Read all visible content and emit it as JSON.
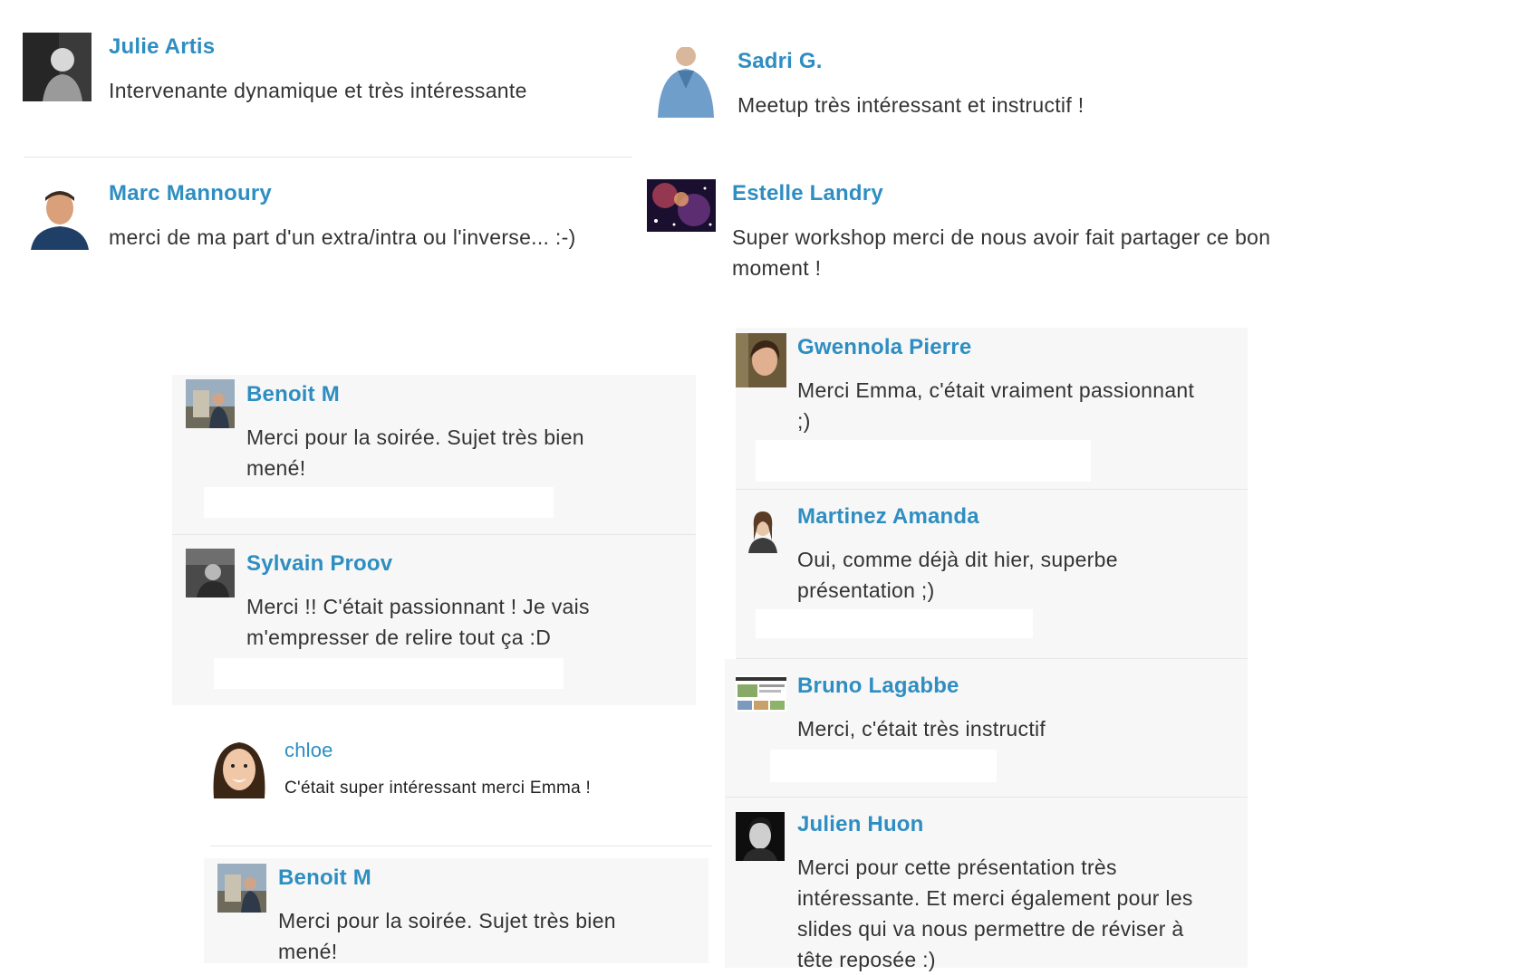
{
  "comments": [
    {
      "name": "Julie Artis",
      "message": "Intervenante dynamique et très intéressante",
      "avatar_icon": "avatar-julie-artis-icon"
    },
    {
      "name": "Sadri G.",
      "message": "Meetup très intéressant et instructif !",
      "avatar_icon": "avatar-sadri-g-icon"
    },
    {
      "name": "Marc Mannoury",
      "message": "merci de ma part d'un extra/intra ou l'inverse... :-)",
      "avatar_icon": "avatar-marc-mannoury-icon"
    },
    {
      "name": "Estelle Landry",
      "message": "Super workshop merci de nous avoir fait partager ce bon moment !",
      "avatar_icon": "avatar-estelle-landry-icon"
    },
    {
      "name": "Gwennola Pierre",
      "message": "Merci Emma, c'était vraiment passionnant ;)",
      "avatar_icon": "avatar-gwennola-pierre-icon"
    },
    {
      "name": "Benoit M",
      "message": "Merci pour la soirée. Sujet très bien mené!",
      "avatar_icon": "avatar-benoit-m-icon"
    },
    {
      "name": "Martinez Amanda",
      "message": "Oui, comme déjà dit hier, superbe présentation ;)",
      "avatar_icon": "avatar-martinez-amanda-icon"
    },
    {
      "name": "Sylvain Proov",
      "message": "Merci !! C'était passionnant ! Je vais m'empresser de relire tout ça :D",
      "avatar_icon": "avatar-sylvain-proov-icon"
    },
    {
      "name": "Bruno Lagabbe",
      "message": "Merci, c'était très instructif",
      "avatar_icon": "avatar-bruno-lagabbe-icon"
    },
    {
      "name": "chloe",
      "message": "C'était super intéressant merci Emma !",
      "avatar_icon": "avatar-chloe-icon"
    },
    {
      "name": "Julien Huon",
      "message": "Merci pour cette présentation très intéressante. Et merci également pour les slides qui va nous permettre de réviser à tête reposée :)",
      "avatar_icon": "avatar-julien-huon-icon"
    },
    {
      "name": "Benoit M",
      "message": "Merci pour la soirée. Sujet très bien mené!",
      "avatar_icon": "avatar-benoit-m-icon"
    }
  ],
  "colors": {
    "name": "#2e8ec2",
    "text": "#333333",
    "card": "#f7f7f7",
    "divider": "#e6e6e6"
  }
}
